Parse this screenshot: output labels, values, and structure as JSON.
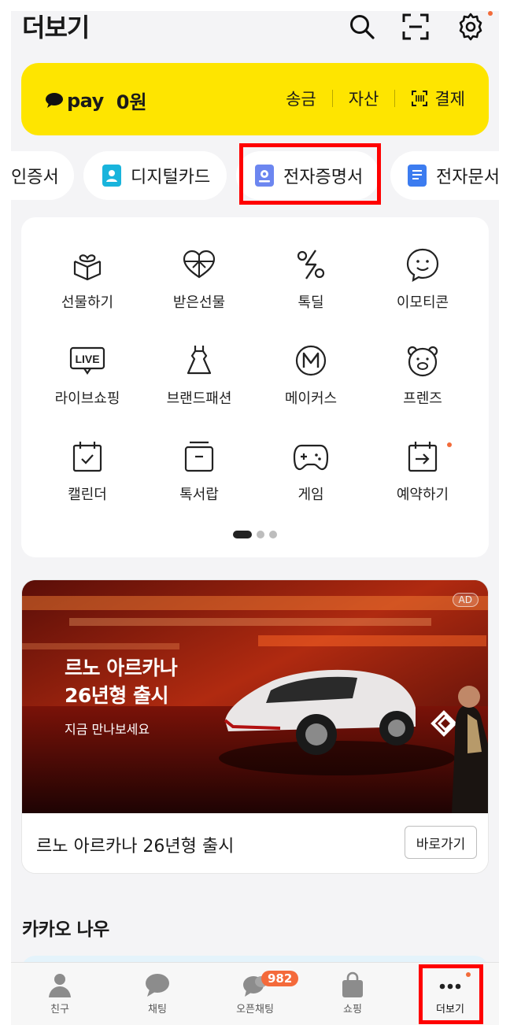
{
  "header": {
    "title": "더보기"
  },
  "pay": {
    "logo": "pay",
    "balance": "0원",
    "actions": [
      "송금",
      "자산",
      "결제"
    ]
  },
  "chips": [
    "인증서",
    "디지털카드",
    "전자증명서",
    "전자문서"
  ],
  "grid": [
    {
      "label": "선물하기",
      "icon": "gift-icon"
    },
    {
      "label": "받은선물",
      "icon": "received-gift-icon"
    },
    {
      "label": "톡딜",
      "icon": "talkdeal-icon"
    },
    {
      "label": "이모티콘",
      "icon": "emoticon-icon"
    },
    {
      "label": "라이브쇼핑",
      "icon": "live-icon"
    },
    {
      "label": "브랜드패션",
      "icon": "dress-icon"
    },
    {
      "label": "메이커스",
      "icon": "makers-icon"
    },
    {
      "label": "프렌즈",
      "icon": "friends-icon"
    },
    {
      "label": "캘린더",
      "icon": "calendar-icon"
    },
    {
      "label": "톡서랍",
      "icon": "drawer-icon"
    },
    {
      "label": "게임",
      "icon": "gamepad-icon"
    },
    {
      "label": "예약하기",
      "icon": "reservation-icon"
    }
  ],
  "pager": {
    "total": 3,
    "active": 1
  },
  "ad": {
    "badge": "AD",
    "headline": "르노 아르카나\n26년형 출시",
    "sub": "지금 만나보세요",
    "title": "르노 아르카나 26년형 출시",
    "button": "바로가기"
  },
  "section": {
    "title": "카카오 나우"
  },
  "tabs": [
    {
      "label": "친구",
      "icon": "person-icon"
    },
    {
      "label": "채팅",
      "icon": "chat-bubble-icon"
    },
    {
      "label": "오픈채팅",
      "icon": "open-chat-icon",
      "badge": "982"
    },
    {
      "label": "쇼핑",
      "icon": "shopping-bag-icon"
    },
    {
      "label": "더보기",
      "icon": "more-dots-icon"
    }
  ],
  "colors": {
    "kakao_yellow": "#fee500",
    "highlight": "#ff0000",
    "badge": "#f46a3b"
  }
}
